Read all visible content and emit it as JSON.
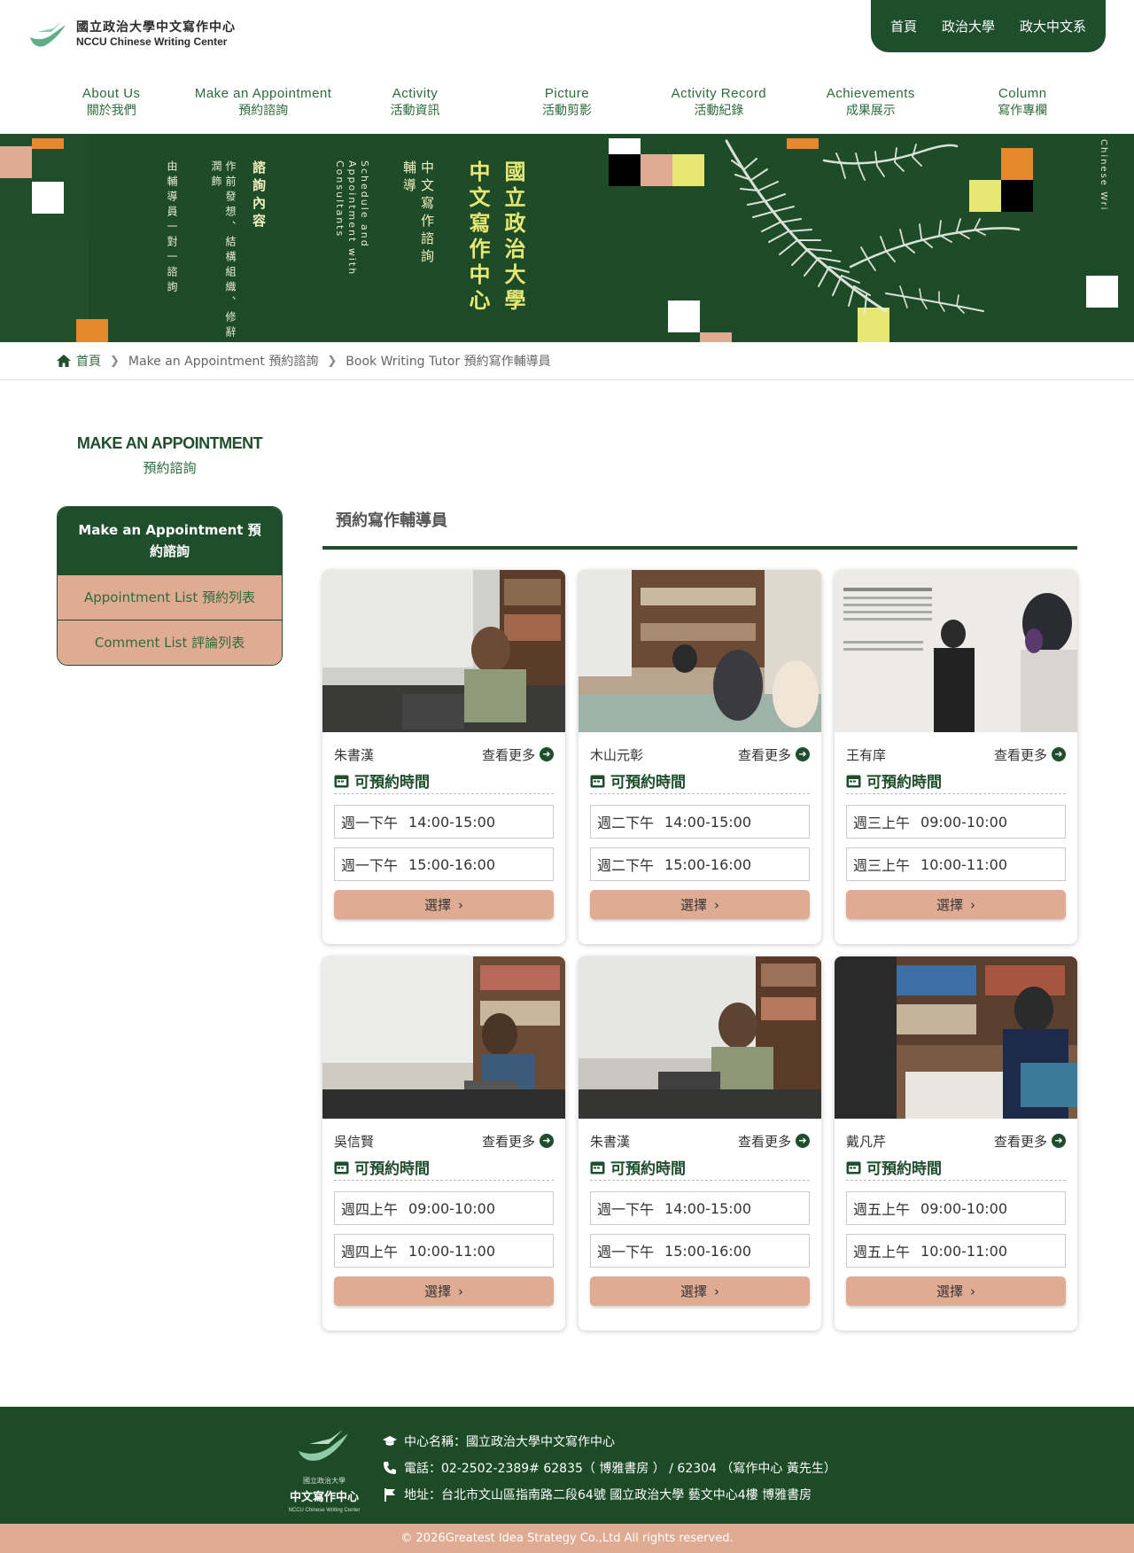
{
  "header": {
    "logo_zh": "國立政治大學中文寫作中心",
    "logo_en": "NCCU Chinese Writing Center",
    "top_links": [
      "首頁",
      "政治大學",
      "政大中文系"
    ],
    "nav": [
      {
        "en": "About Us",
        "zh": "關於我們"
      },
      {
        "en": "Make an Appointment",
        "zh": "預約諮詢"
      },
      {
        "en": "Activity",
        "zh": "活動資訊"
      },
      {
        "en": "Picture",
        "zh": "活動剪影"
      },
      {
        "en": "Activity Record",
        "zh": "活動紀錄"
      },
      {
        "en": "Achievements",
        "zh": "成果展示"
      },
      {
        "en": "Column",
        "zh": "寫作專欄"
      }
    ]
  },
  "banner": {
    "col1": "由輔導員一對一諮詢",
    "col2": "作前發想、結構組織、修辭潤飾",
    "col3": "諮詢內容",
    "col4": "Schedule and Appointment with Consultants",
    "col5": "中文寫作諮詢輔導",
    "col6": "中文寫作中心",
    "col7": "國立政治大學",
    "side": "Chinese Wri"
  },
  "breadcrumb": {
    "home": "首頁",
    "items": [
      "Make an Appointment 預約諮詢",
      "Book Writing Tutor 預約寫作輔導員"
    ]
  },
  "sidebar": {
    "title_en": "MAKE AN APPOINTMENT",
    "title_zh": "預約諮詢",
    "active": "Make an Appointment 預約諮詢",
    "items": [
      "Appointment List 預約列表",
      "Comment List 評論列表"
    ]
  },
  "content": {
    "title": "預約寫作輔導員",
    "more_label": "查看更多",
    "available_label": "可預約時間",
    "select_label": "選擇",
    "tutors": [
      {
        "name": "朱書漢",
        "slots": [
          {
            "day": "週一下午",
            "time": "14:00-15:00"
          },
          {
            "day": "週一下午",
            "time": "15:00-16:00"
          }
        ]
      },
      {
        "name": "木山元彰",
        "slots": [
          {
            "day": "週二下午",
            "time": "14:00-15:00"
          },
          {
            "day": "週二下午",
            "time": "15:00-16:00"
          }
        ]
      },
      {
        "name": "王有庠",
        "slots": [
          {
            "day": "週三上午",
            "time": "09:00-10:00"
          },
          {
            "day": "週三上午",
            "time": "10:00-11:00"
          }
        ]
      },
      {
        "name": "吳信賢",
        "slots": [
          {
            "day": "週四上午",
            "time": "09:00-10:00"
          },
          {
            "day": "週四上午",
            "time": "10:00-11:00"
          }
        ]
      },
      {
        "name": "朱書漢",
        "slots": [
          {
            "day": "週一下午",
            "time": "14:00-15:00"
          },
          {
            "day": "週一下午",
            "time": "15:00-16:00"
          }
        ]
      },
      {
        "name": "戴凡芹",
        "slots": [
          {
            "day": "週五上午",
            "time": "09:00-10:00"
          },
          {
            "day": "週五上午",
            "time": "10:00-11:00"
          }
        ]
      }
    ]
  },
  "footer": {
    "logo_small": "國立政治大學",
    "logo_main": "中文寫作中心",
    "logo_en": "NCCU Chinese Writing Center",
    "name": "中心名稱：國立政治大學中文寫作中心",
    "phone": "電話：02-2502-2389# 62835（ 博雅書房 ） / 62304 （寫作中心 黃先生）",
    "address": "地址：台北市文山區指南路二段64號 國立政治大學 藝文中心4樓 博雅書房",
    "copyright": "© 2026Greatest Idea Strategy Co.,Ltd All rights reserved."
  },
  "colors": {
    "primary_green": "#1f4e2c",
    "accent_salmon": "#e0ab93",
    "banner_yellow": "#e6e873",
    "banner_orange": "#e58a2c"
  }
}
